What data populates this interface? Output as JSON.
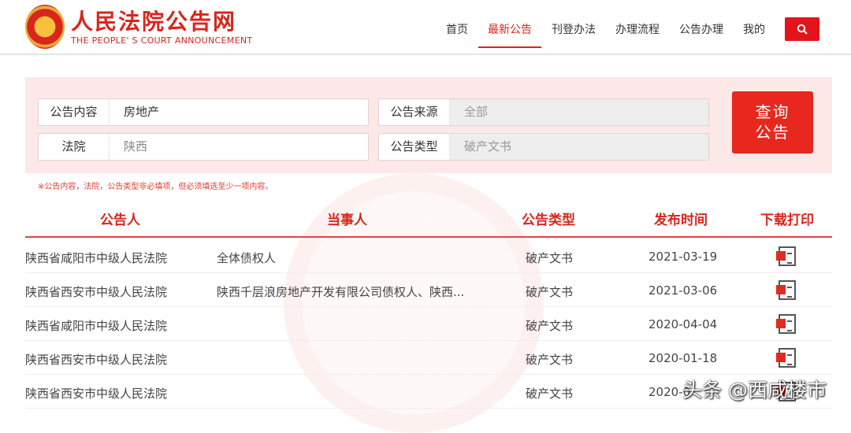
{
  "header": {
    "logo_cn": "人民法院公告网",
    "logo_en": "THE PEOPLE' S COURT ANNOUNCEMENT",
    "nav": [
      "首页",
      "最新公告",
      "刊登办法",
      "办理流程",
      "公告办理",
      "我的"
    ],
    "search_icon": "search-icon"
  },
  "search": {
    "content_label": "公告内容",
    "content_value": "房地产",
    "court_label": "法院",
    "court_value": "陕西",
    "source_label": "公告来源",
    "source_value": "全部",
    "type_label": "公告类型",
    "type_value": "破产文书",
    "query_button": [
      "查询",
      "公告"
    ],
    "note": "※公告内容，法院，公告类型非必填项，但必须填选至少一项内容。"
  },
  "table": {
    "headers": [
      "公告人",
      "当事人",
      "公告类型",
      "发布时间",
      "下载打印"
    ],
    "rows": [
      {
        "court": "陕西省咸阳市中级人民法院",
        "party": "全体债权人",
        "type": "破产文书",
        "date": "2021-03-19"
      },
      {
        "court": "陕西省西安市中级人民法院",
        "party": "陕西千层浪房地产开发有限公司债权人、陕西...",
        "type": "破产文书",
        "date": "2021-03-06"
      },
      {
        "court": "陕西省咸阳市中级人民法院",
        "party": "",
        "type": "破产文书",
        "date": "2020-04-04"
      },
      {
        "court": "陕西省西安市中级人民法院",
        "party": "",
        "type": "破产文书",
        "date": "2020-01-18"
      },
      {
        "court": "陕西省西安市中级人民法院",
        "party": "",
        "type": "破产文书",
        "date": "2020-0"
      }
    ]
  },
  "watermark": "头条 @西咸楼市"
}
